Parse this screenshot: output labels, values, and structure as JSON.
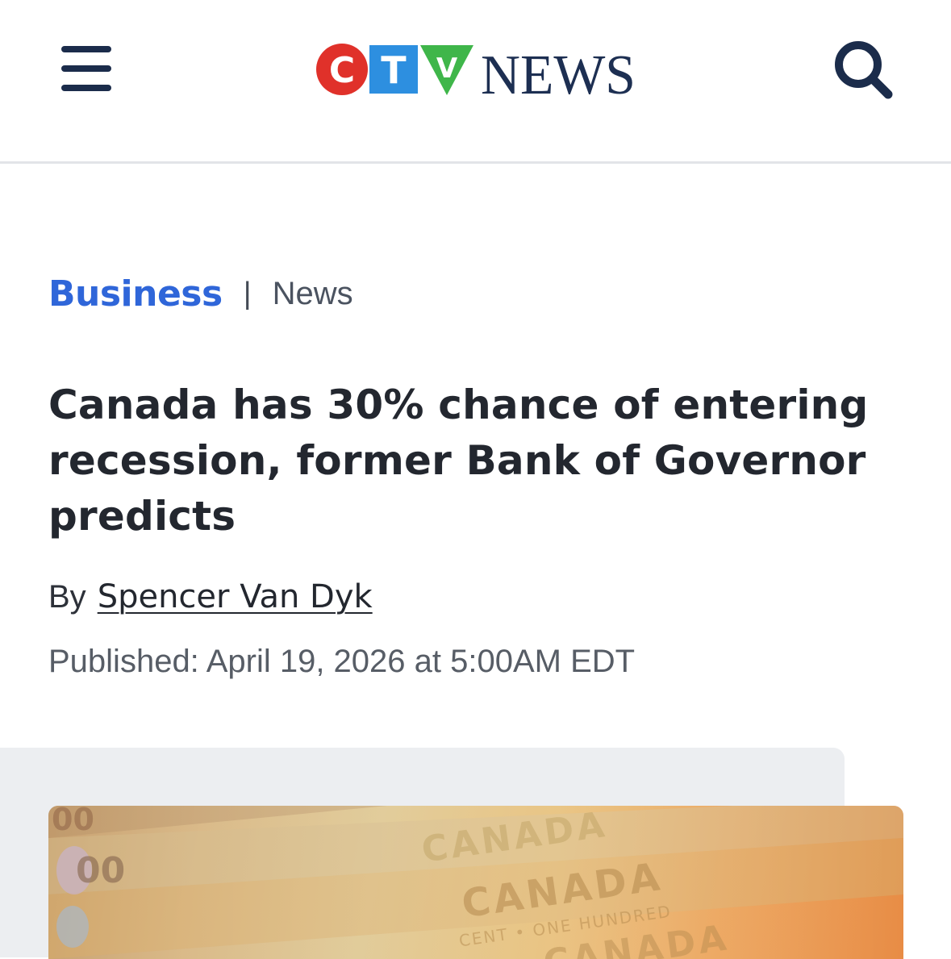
{
  "header": {
    "logo": {
      "letters": [
        "C",
        "T",
        "V"
      ],
      "wordmark": "NEWS",
      "colors": {
        "c": "#e0312a",
        "t": "#2d8fe0",
        "v": "#3fb64a",
        "wordmark": "#1d2f52"
      }
    },
    "menu_icon": "hamburger-menu-icon",
    "search_icon": "search-icon"
  },
  "breadcrumb": {
    "section": "Business",
    "separator": "|",
    "subsection": "News"
  },
  "article": {
    "headline": "Canada has 30% chance of entering recession, former Bank of Governor predicts",
    "byline_prefix": "By",
    "author": "Spencer Van Dyk",
    "published": "Published: April 19, 2026 at 5:00AM EDT"
  },
  "media": {
    "banknote_text": [
      "CANADA",
      "CANADA",
      "CENT • ONE HUNDRED",
      "00"
    ]
  },
  "colors": {
    "accent_link": "#2f66d9",
    "text_primary": "#23272f",
    "text_secondary": "#575d66",
    "nav_icon": "#1b2c4b"
  }
}
